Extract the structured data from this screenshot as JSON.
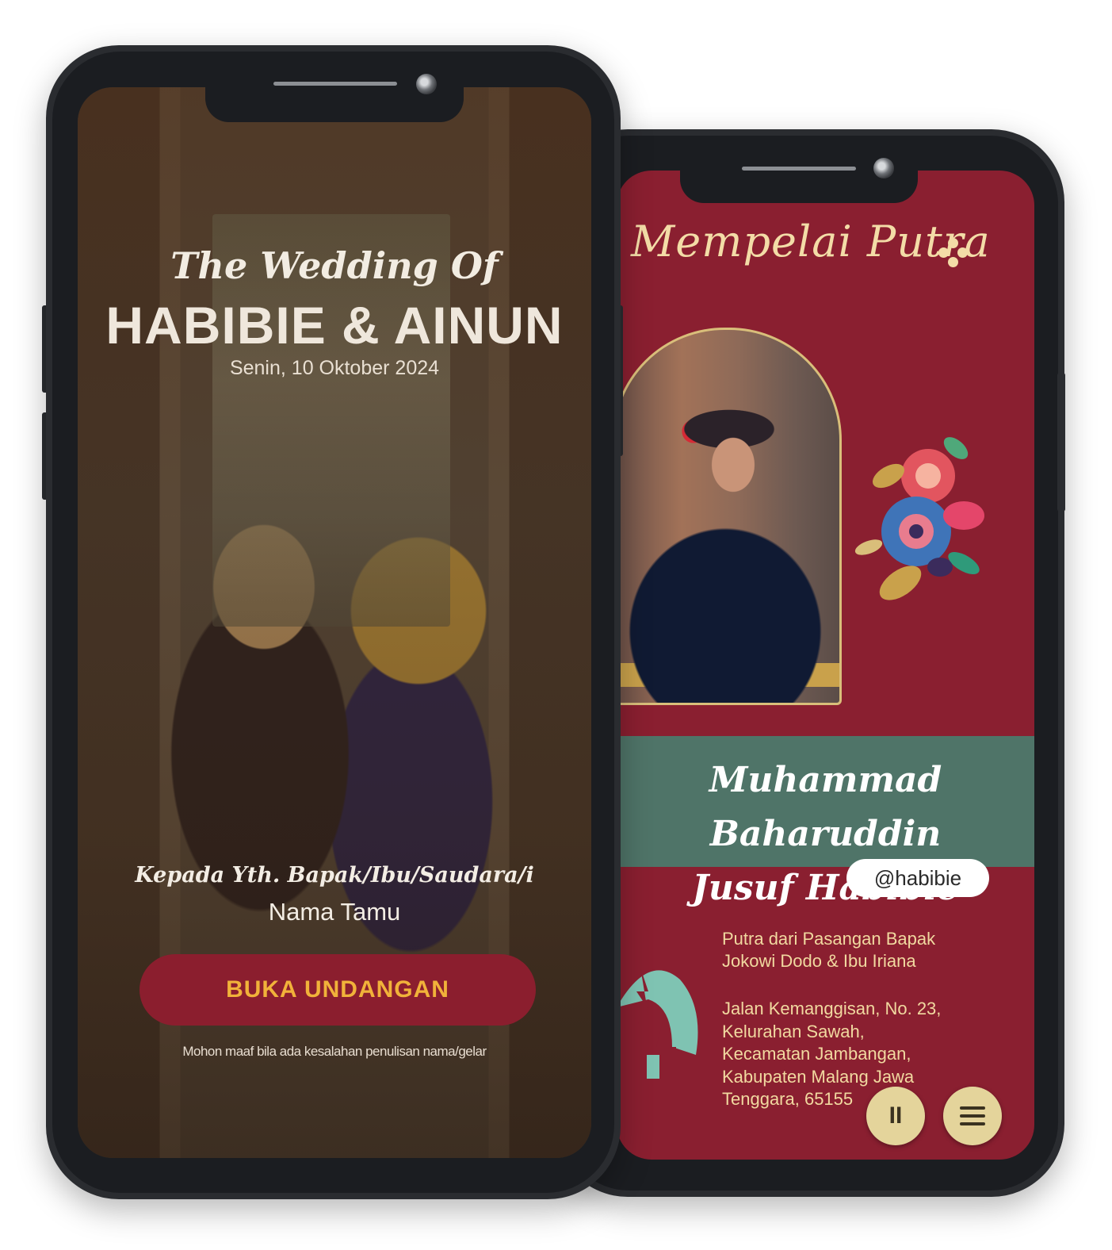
{
  "invitation": {
    "heading": "The Wedding Of",
    "couple": "HABIBIE & AINUN",
    "date": "Senin, 10 Oktober 2024",
    "greeting": "Kepada Yth. Bapak/Ibu/Saudara/i",
    "guest_name": "Nama Tamu",
    "open_button": "BUKA UNDANGAN",
    "disclaimer": "Mohon maaf bila ada kesalahan penulisan nama/gelar"
  },
  "groom": {
    "section_title": "Mempelai Putra",
    "name_line1": "Muhammad Baharuddin",
    "name_line2": "Jusuf Habibie",
    "instagram": "@habibie",
    "parents_line1": "Putra dari Pasangan Bapak",
    "parents_line2": "Jokowi Dodo & Ibu Iriana",
    "address_lines": [
      "Jalan Kemanggisan, No. 23,",
      "Kelurahan Sawah,",
      "Kecamatan Jambangan,",
      "Kabupaten Malang Jawa",
      "Tenggara, 65155"
    ]
  },
  "controls": {
    "pause_icon": "pause-icon",
    "pause_glyph": "II",
    "menu_icon": "menu-icon"
  },
  "colors": {
    "maroon": "#8a1f30",
    "teal": "#4f7468",
    "gold_text": "#f1b23a",
    "cream": "#e4d49b"
  }
}
